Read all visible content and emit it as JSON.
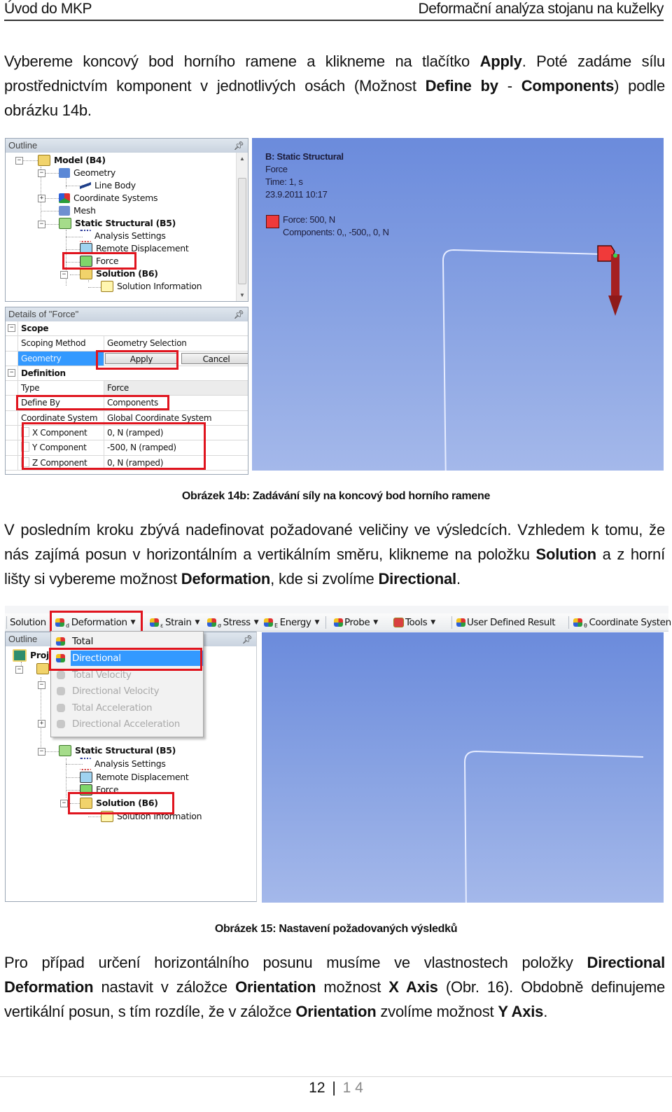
{
  "header": {
    "left": "Úvod do MKP",
    "right": "Deformační analýza stojanu na kuželky"
  },
  "paragraph1": {
    "parts": [
      {
        "text": "Vybereme koncový bod horního ramene a klikneme na tlačítko ",
        "bold": false
      },
      {
        "text": "Apply",
        "bold": true
      },
      {
        "text": ". Poté zadáme sílu prostřednictvím komponent v jednotlivých osách (Možnost ",
        "bold": false
      },
      {
        "text": "Define by",
        "bold": true
      },
      {
        "text": " - ",
        "bold": false
      },
      {
        "text": "Components",
        "bold": true
      },
      {
        "text": ") podle obrázku 14b.",
        "bold": false
      }
    ]
  },
  "figure14b": {
    "caption": "Obrázek 14b: Zadávání síly na koncový bod horního ramene",
    "outline": {
      "title": "Outline",
      "items": [
        {
          "label": "Model (B4)",
          "bold": true,
          "icon": "model-icon"
        },
        {
          "label": "Geometry",
          "bold": false,
          "icon": "geometry-icon"
        },
        {
          "label": "Line Body",
          "bold": false,
          "icon": "line-body-icon"
        },
        {
          "label": "Coordinate Systems",
          "bold": false,
          "icon": "coordinate-systems-icon"
        },
        {
          "label": "Mesh",
          "bold": false,
          "icon": "mesh-icon"
        },
        {
          "label": "Static Structural (B5)",
          "bold": true,
          "icon": "static-structural-icon"
        },
        {
          "label": "Analysis Settings",
          "bold": false,
          "icon": "analysis-settings-icon"
        },
        {
          "label": "Remote Displacement",
          "bold": false,
          "icon": "remote-displacement-icon"
        },
        {
          "label": "Force",
          "bold": false,
          "icon": "force-icon"
        },
        {
          "label": "Solution (B6)",
          "bold": true,
          "icon": "solution-icon"
        },
        {
          "label": "Solution Information",
          "bold": false,
          "icon": "solution-information-icon"
        }
      ]
    },
    "details": {
      "title": "Details of \"Force\"",
      "scope_label": "Scope",
      "scoping_method_key": "Scoping Method",
      "scoping_method_value": "Geometry Selection",
      "geometry_key": "Geometry",
      "apply_label": "Apply",
      "cancel_label": "Cancel",
      "definition_label": "Definition",
      "type_key": "Type",
      "type_value": "Force",
      "define_by_key": "Define By",
      "define_by_value": "Components",
      "coord_key": "Coordinate System",
      "coord_value": "Global Coordinate System",
      "x_key": "X Component",
      "x_value": "0, N  (ramped)",
      "y_key": "Y Component",
      "y_value": "-500, N  (ramped)",
      "z_key": "Z Component",
      "z_value": "0, N  (ramped)"
    },
    "viewport": {
      "title": "B: Static Structural",
      "subtitle": "Force",
      "time": "Time: 1, s",
      "date": "23.9.2011 10:17",
      "legend_line1": "Force: 500, N",
      "legend_line2": "Components: 0,, -500,, 0, N",
      "legend_color": "#f03a3a"
    }
  },
  "paragraph2": {
    "parts": [
      {
        "text": "V posledním kroku zbývá nadefinovat požadované veličiny ve výsledcích. Vzhledem k tomu, že nás zajímá posun v horizontálním a vertikálním směru, klikneme na položku ",
        "bold": false
      },
      {
        "text": "Solution",
        "bold": true
      },
      {
        "text": " a z horní lišty si vybereme možnost ",
        "bold": false
      },
      {
        "text": "Deformation",
        "bold": true
      },
      {
        "text": ", kde si zvolíme ",
        "bold": false
      },
      {
        "text": "Directional",
        "bold": true
      },
      {
        "text": ".",
        "bold": false
      }
    ]
  },
  "figure15": {
    "caption": "Obrázek 15: Nastavení požadovaných výsledků",
    "toolbar": {
      "solution": "Solution",
      "deformation": "Deformation",
      "strain": "Strain",
      "stress": "Stress",
      "energy": "Energy",
      "probe": "Probe",
      "tools": "Tools",
      "user_defined": "User Defined Result",
      "coordinate_systems": "Coordinate Systen"
    },
    "dropdown": [
      {
        "label": "Total",
        "state": "normal"
      },
      {
        "label": "Directional",
        "state": "selected"
      },
      {
        "label": "Total Velocity",
        "state": "disabled"
      },
      {
        "label": "Directional Velocity",
        "state": "disabled"
      },
      {
        "label": "Total Acceleration",
        "state": "disabled"
      },
      {
        "label": "Directional Acceleration",
        "state": "disabled"
      }
    ],
    "outline": {
      "title": "Outline",
      "project": "Proj",
      "items": [
        {
          "label": "Static Structural (B5)",
          "bold": true
        },
        {
          "label": "Analysis Settings",
          "bold": false
        },
        {
          "label": "Remote Displacement",
          "bold": false
        },
        {
          "label": "Force",
          "bold": false
        },
        {
          "label": "Solution (B6)",
          "bold": true
        },
        {
          "label": "Solution Information",
          "bold": false
        }
      ]
    }
  },
  "paragraph3": {
    "parts": [
      {
        "text": "Pro případ určení horizontálního posunu musíme ve vlastnostech položky ",
        "bold": false
      },
      {
        "text": "Directional Deformation",
        "bold": true
      },
      {
        "text": " nastavit v záložce ",
        "bold": false
      },
      {
        "text": "Orientation",
        "bold": true
      },
      {
        "text": " možnost ",
        "bold": false
      },
      {
        "text": "X Axis",
        "bold": true
      },
      {
        "text": " (Obr. 16). Obdobně definujeme vertikální posun, s tím rozdíle, že v záložce ",
        "bold": false
      },
      {
        "text": "Orientation",
        "bold": true
      },
      {
        "text": " zvolíme možnost ",
        "bold": false
      },
      {
        "text": "Y Axis",
        "bold": true
      },
      {
        "text": ".",
        "bold": false
      }
    ]
  },
  "footer": {
    "page": "12",
    "separator": "|",
    "total": "1 4"
  },
  "colors": {
    "highlight_red": "#e0141e",
    "selection_blue": "#3399ff"
  }
}
